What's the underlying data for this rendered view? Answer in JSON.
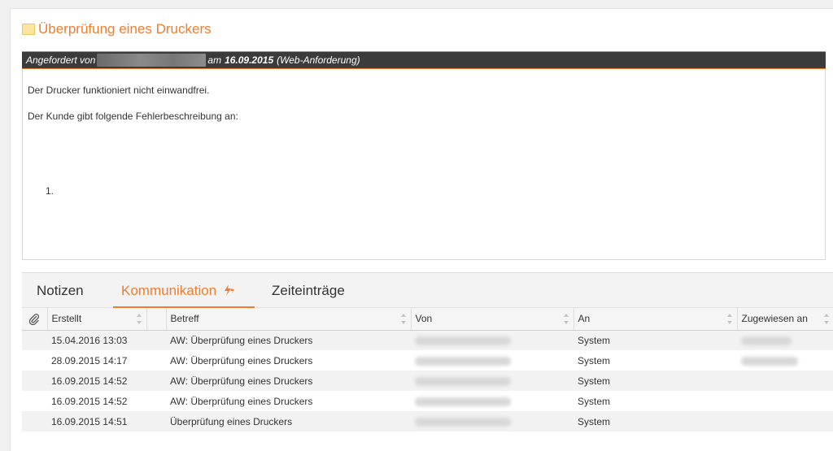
{
  "ticket": {
    "title": "Überprüfung eines Druckers",
    "requested_prefix": "Angefordert von",
    "requested_mid": "am",
    "requested_date": "16.09.2015",
    "requested_source": "(Web-Anforderung)"
  },
  "description": {
    "line1": "Der Drucker funktioniert nicht einwandfrei.",
    "line2": "Der Kunde gibt folgende Fehlerbeschreibung an:",
    "list_item": "1."
  },
  "tabs": [
    {
      "label": "Notizen"
    },
    {
      "label": "Kommunikation"
    },
    {
      "label": "Zeiteinträge"
    }
  ],
  "columns": [
    "Erstellt",
    "Betreff",
    "Von",
    "An",
    "Zugewiesen an"
  ],
  "rows": [
    {
      "created": "15.04.2016 13:03",
      "subject": "AW: Überprüfung eines Druckers",
      "to": "System"
    },
    {
      "created": "28.09.2015 14:17",
      "subject": "AW: Überprüfung eines Druckers",
      "to": "System"
    },
    {
      "created": "16.09.2015 14:52",
      "subject": "AW: Überprüfung eines Druckers",
      "to": "System"
    },
    {
      "created": "16.09.2015 14:52",
      "subject": "AW: Überprüfung eines Druckers",
      "to": "System"
    },
    {
      "created": "16.09.2015 14:51",
      "subject": "Überprüfung eines Druckers",
      "to": "System"
    }
  ],
  "colors": {
    "accent": "#f07c2e",
    "header_bar": "#3b3b3b"
  },
  "icons": [
    "ticket-icon",
    "lightning-icon",
    "paperclip-icon",
    "sort-icon"
  ]
}
